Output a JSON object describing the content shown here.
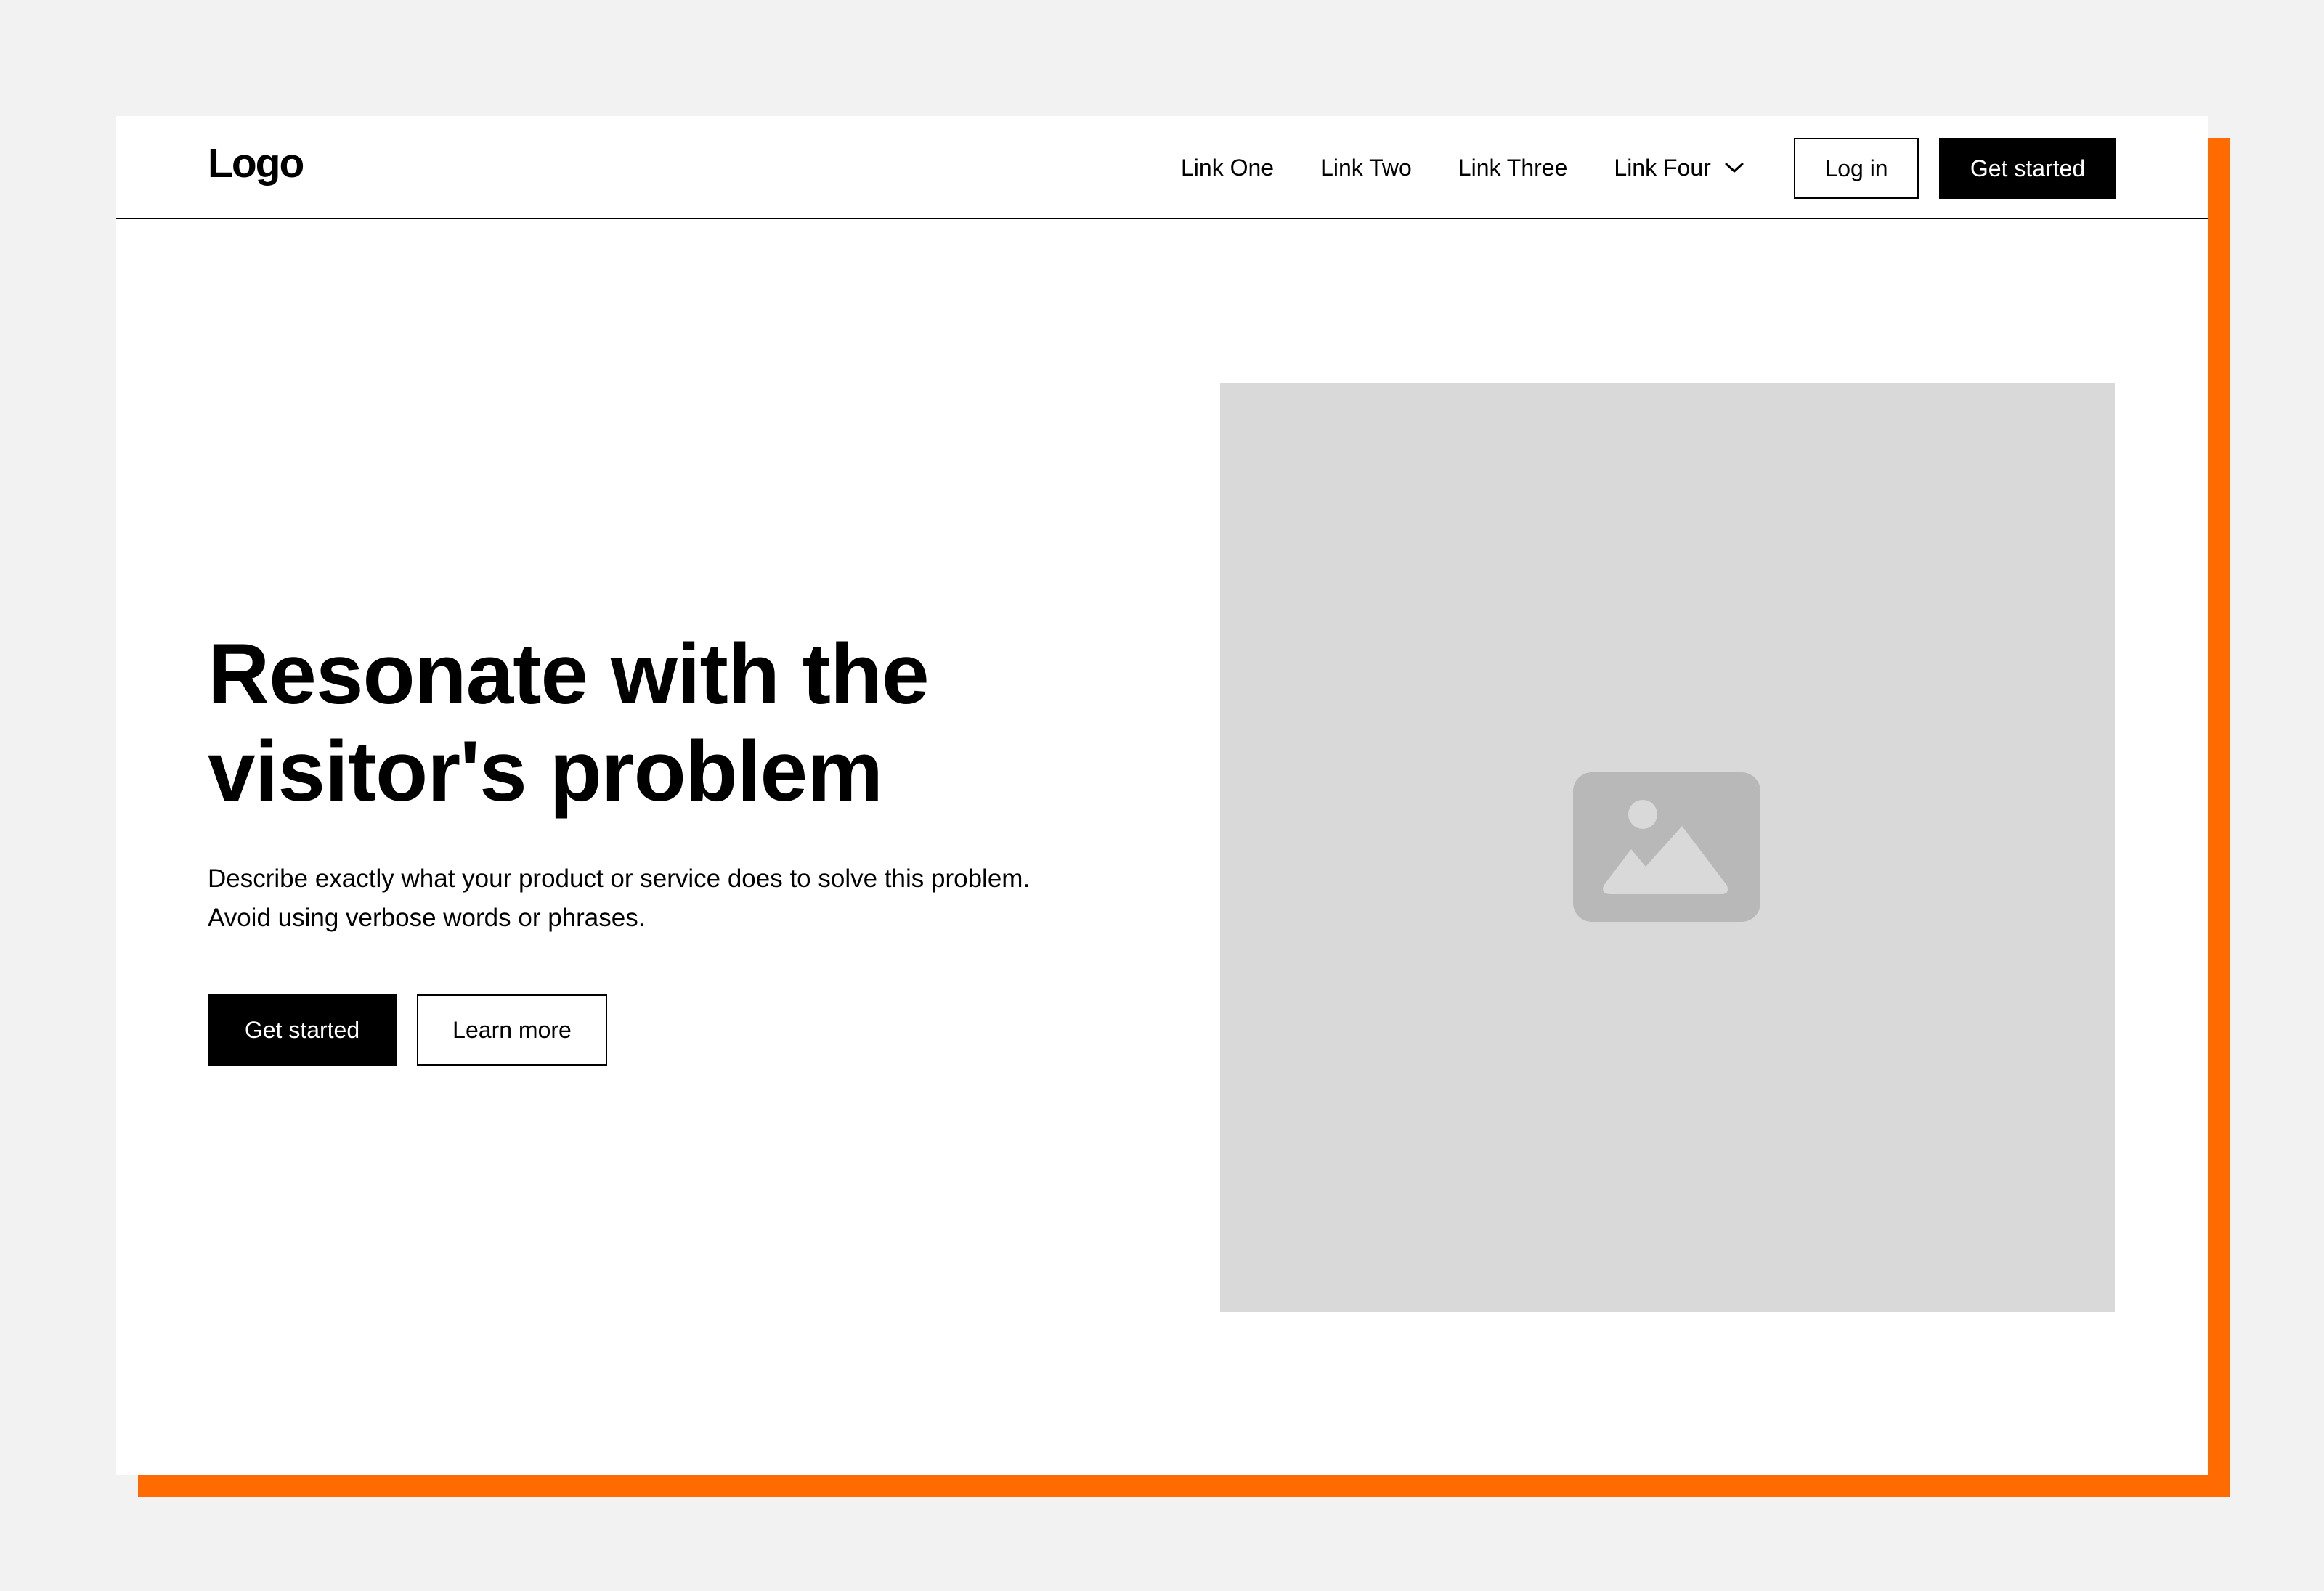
{
  "navbar": {
    "logo": "Logo",
    "links": [
      "Link One",
      "Link Two",
      "Link Three"
    ],
    "dropdown_label": "Link Four",
    "login_label": "Log in",
    "get_started_label": "Get started"
  },
  "hero": {
    "headline_line1": "Resonate with the",
    "headline_line2": "visitor's problem",
    "description_line1": "Describe exactly what your product or service does to solve this problem.",
    "description_line2": "Avoid using verbose words or phrases.",
    "primary_button": "Get started",
    "secondary_button": "Learn more"
  },
  "colors": {
    "accent": "#ff6b00",
    "background": "#f2f2f2",
    "placeholder": "#d9d9d9",
    "placeholder_icon": "#b8b8b8"
  },
  "icons": {
    "dropdown": "chevron-down-icon",
    "image": "image-placeholder-icon"
  }
}
